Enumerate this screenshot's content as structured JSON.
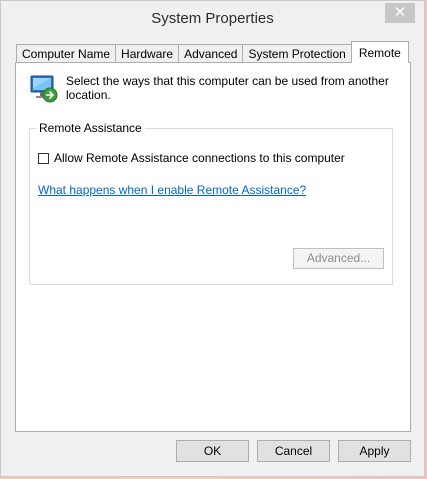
{
  "window": {
    "title": "System Properties",
    "close_glyph": "✕"
  },
  "tabs": [
    {
      "label": "Computer Name",
      "active": false
    },
    {
      "label": "Hardware",
      "active": false
    },
    {
      "label": "Advanced",
      "active": false
    },
    {
      "label": "System Protection",
      "active": false
    },
    {
      "label": "Remote",
      "active": true
    }
  ],
  "remote": {
    "intro_icon": "remote-computer-icon",
    "intro": "Select the ways that this computer can be used from another location.",
    "assistance": {
      "group_label": "Remote Assistance",
      "checkbox_label": "Allow Remote Assistance connections to this computer",
      "checked": false,
      "help_link": "What happens when I enable Remote Assistance?",
      "advanced_label": "Advanced..."
    }
  },
  "buttons": {
    "ok": "OK",
    "cancel": "Cancel",
    "apply": "Apply"
  },
  "colors": {
    "link": "#0066cc",
    "close_button": "#c7c7c7",
    "dialog_bg": "#f0f0f0"
  }
}
